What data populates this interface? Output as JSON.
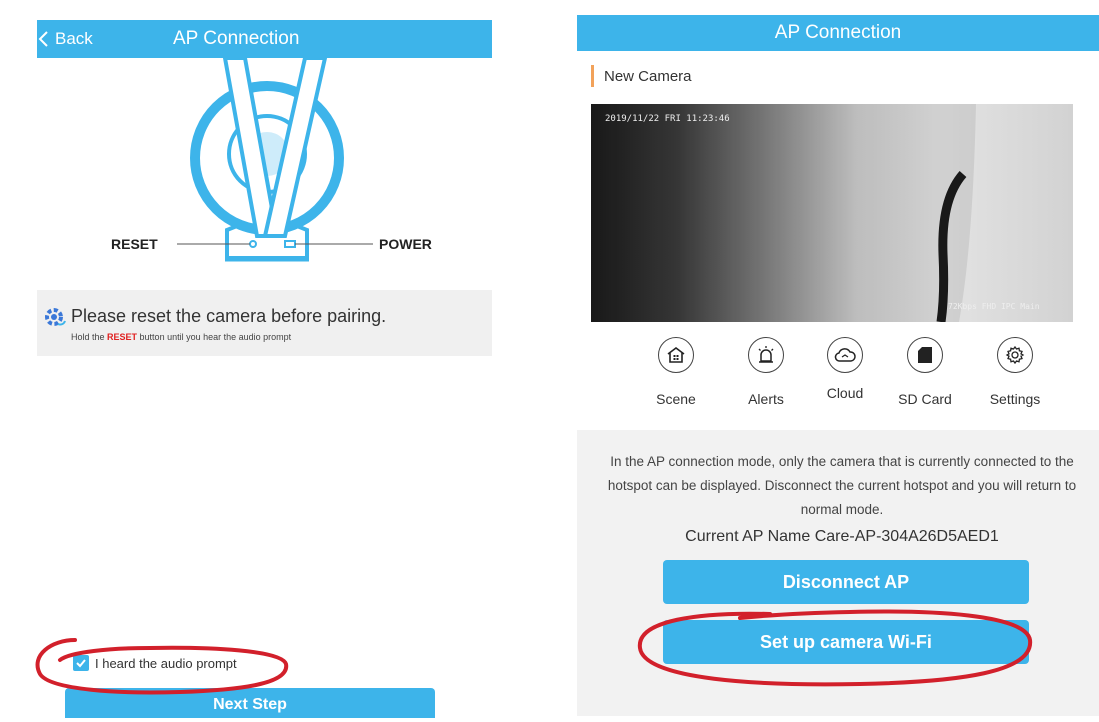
{
  "left_screen": {
    "header": {
      "back_label": "Back",
      "title": "AP Connection"
    },
    "diagram": {
      "reset_label": "RESET",
      "power_label": "POWER"
    },
    "info": {
      "icon": "gear-refresh-icon",
      "main_text": "Please reset the camera before pairing.",
      "sub_prefix": "Hold the ",
      "sub_highlight": "RESET",
      "sub_suffix": " button until you hear the audio prompt"
    },
    "checkbox": {
      "label": "I heard the audio prompt",
      "checked": true
    },
    "next_button": "Next Step"
  },
  "right_screen": {
    "header": {
      "title": "AP Connection"
    },
    "camera_name": "New Camera",
    "video": {
      "timestamp": "2019/11/22  FRI 11:23:46",
      "osd": "72Kbps FHD IPC Main"
    },
    "controls": [
      {
        "label": "Scene",
        "icon": "home-grid-icon"
      },
      {
        "label": "Alerts",
        "icon": "alarm-light-icon"
      },
      {
        "label": "Cloud",
        "icon": "cloud-icon"
      },
      {
        "label": "SD Card",
        "icon": "sd-card-icon"
      },
      {
        "label": "Settings",
        "icon": "gear-icon"
      }
    ],
    "ap_info": "In the AP connection mode, only the camera that is currently connected to the hotspot can be displayed. Disconnect the current hotspot and you will return to normal mode.",
    "ap_name": "Current AP Name Care-AP-304A26D5AED1",
    "disconnect_button": "Disconnect AP",
    "setup_wifi_button": "Set up camera Wi-Fi"
  },
  "colors": {
    "accent": "#3db4ea",
    "annotation": "#d2202b",
    "highlight": "#e02020"
  }
}
